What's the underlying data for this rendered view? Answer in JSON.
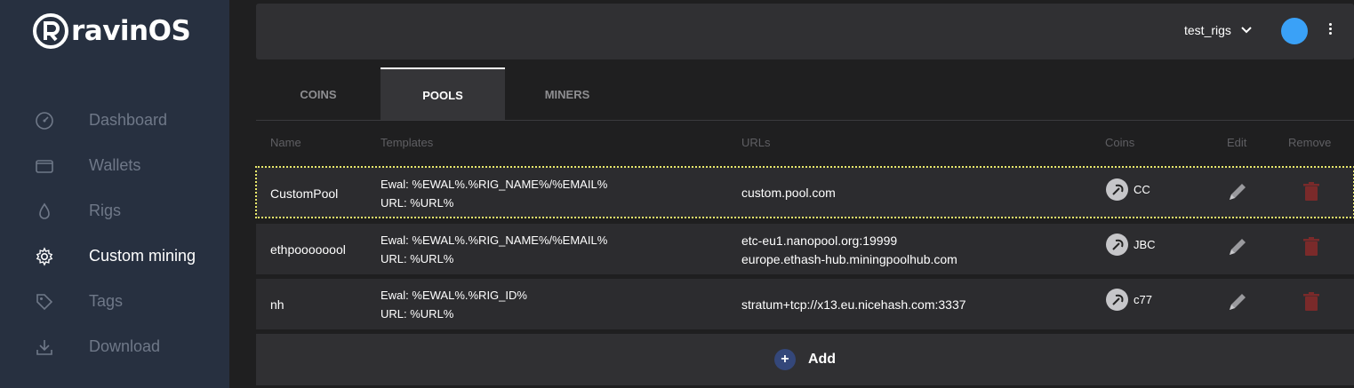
{
  "brand": {
    "name": "ravinOS"
  },
  "sidebar": {
    "items": [
      {
        "label": "Dashboard",
        "icon": "speedometer-icon",
        "active": false
      },
      {
        "label": "Wallets",
        "icon": "wallet-icon",
        "active": false
      },
      {
        "label": "Rigs",
        "icon": "drop-icon",
        "active": false
      },
      {
        "label": "Custom mining",
        "icon": "gear-icon",
        "active": true
      },
      {
        "label": "Tags",
        "icon": "tag-icon",
        "active": false
      },
      {
        "label": "Download",
        "icon": "download-icon",
        "active": false
      }
    ]
  },
  "header": {
    "rig_selector": "test_rigs",
    "avatar_color": "#3aa1f7"
  },
  "tabs": [
    {
      "label": "COINS",
      "active": false
    },
    {
      "label": "POOLS",
      "active": true
    },
    {
      "label": "MINERS",
      "active": false
    }
  ],
  "table": {
    "columns": [
      "Name",
      "Templates",
      "URLs",
      "Coins",
      "Edit",
      "Remove"
    ],
    "rows": [
      {
        "name": "CustomPool",
        "template_line1": "Ewal: %EWAL%.%RIG_NAME%/%EMAIL%",
        "template_line2": "URL: %URL%",
        "url_line1": "custom.pool.com",
        "url_line2": "",
        "coin": "CC"
      },
      {
        "name": "ethpoooooool",
        "template_line1": "Ewal: %EWAL%.%RIG_NAME%/%EMAIL%",
        "template_line2": "URL: %URL%",
        "url_line1": "etc-eu1.nanopool.org:19999",
        "url_line2": "europe.ethash-hub.miningpoolhub.com",
        "coin": "JBC"
      },
      {
        "name": "nh",
        "template_line1": "Ewal: %EWAL%.%RIG_ID%",
        "template_line2": "URL: %URL%",
        "url_line1": "stratum+tcp://x13.eu.nicehash.com:3337",
        "url_line2": "",
        "coin": "c77"
      }
    ]
  },
  "add": {
    "icon": "+",
    "label": "Add"
  },
  "colors": {
    "sidebar_bg": "#273040",
    "accent_blue": "#3aa1f7",
    "remove_red": "#7a2a2a",
    "highlight": "#e8e86a"
  }
}
